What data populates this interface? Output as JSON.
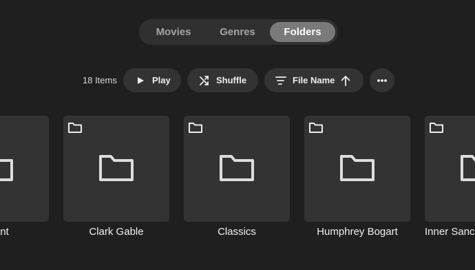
{
  "tabs": [
    {
      "label": "Movies",
      "active": false
    },
    {
      "label": "Genres",
      "active": false
    },
    {
      "label": "Folders",
      "active": true
    }
  ],
  "toolbar": {
    "item_count": "18 Items",
    "play_label": "Play",
    "shuffle_label": "Shuffle",
    "sort_label": "File Name",
    "sort_direction_icon": "arrow-up-icon",
    "more_icon": "more-horizontal-icon"
  },
  "folders": [
    {
      "title": "Grant"
    },
    {
      "title": "Clark Gable"
    },
    {
      "title": "Classics"
    },
    {
      "title": "Humphrey Bogart"
    },
    {
      "title": "Inner Sanc"
    }
  ],
  "colors": {
    "background": "#1f1f1f",
    "card": "#333333",
    "active_tab": "#7a7a7a",
    "text": "#f0f0f0"
  }
}
